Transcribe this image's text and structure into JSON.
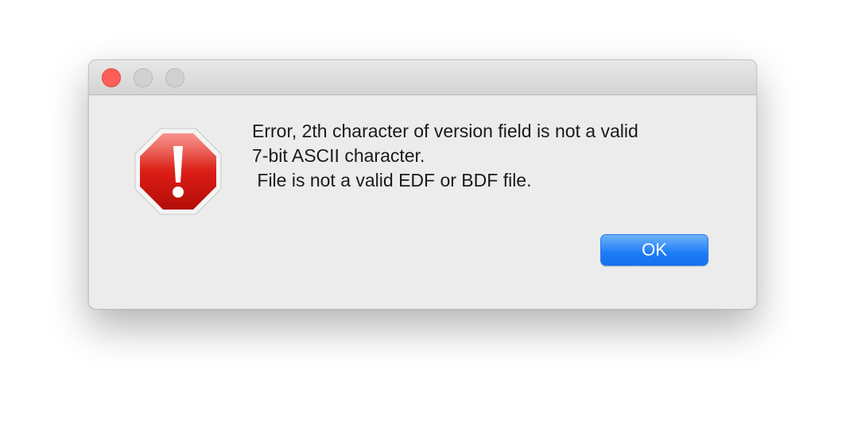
{
  "window": {
    "controls": {
      "close": "close-button",
      "minimize": "minimize-button",
      "zoom": "zoom-button"
    }
  },
  "dialog": {
    "icon": "stop-error-icon",
    "icon_colors": {
      "fill": "#d01010",
      "border": "#ffffff",
      "glyph": "#ffffff"
    },
    "message_lines": [
      "Error, 2th character of version field is not a valid",
      "7-bit ASCII character.",
      " File is not a valid EDF or BDF file."
    ],
    "ok_label": "OK"
  },
  "colors": {
    "accent": "#1e7cf5",
    "close": "#fe5f57",
    "inactive_control": "#d1d1d1",
    "dialog_bg": "#ececec"
  }
}
